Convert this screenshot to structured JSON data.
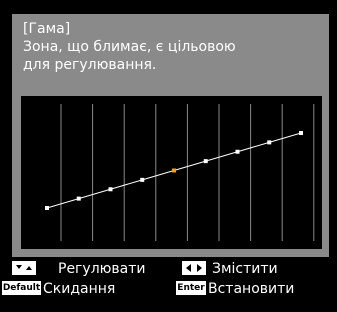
{
  "header": {
    "title": "[Гама]",
    "line1": "Зона, що блимає, є цільовою",
    "line2": "для регулювання."
  },
  "graph": {
    "point_count": 9,
    "highlighted_index": 4,
    "colors": {
      "line": "#ffffff",
      "point": "#ffffff",
      "highlight": "#f0a020",
      "grid": "#8a8a8a"
    }
  },
  "footer": {
    "adjust_label": "Регулювати",
    "move_label": "Змістити",
    "default_key": "Default",
    "reset_label": "Скидання",
    "enter_key": "Enter",
    "set_label": "Встановити"
  }
}
